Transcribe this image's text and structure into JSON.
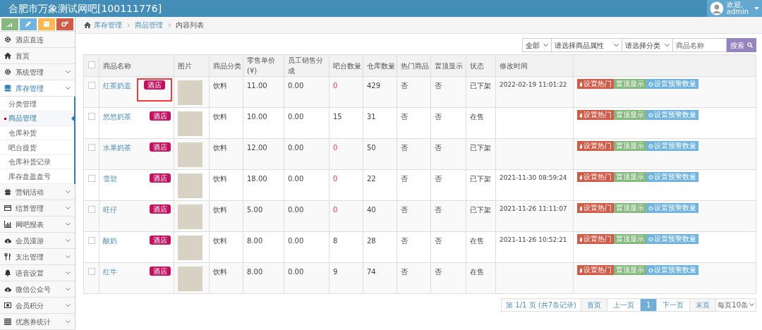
{
  "header": {
    "title": "合肥市万象测试网吧[100111776]",
    "welcome": "欢迎,",
    "user": "admin"
  },
  "sidebar": {
    "items": [
      {
        "label": "酒店直连",
        "expandable": false,
        "expanded": false
      },
      {
        "label": "首页",
        "expandable": false,
        "expanded": false
      },
      {
        "label": "系统管理",
        "expandable": true,
        "expanded": false
      },
      {
        "label": "库存管理",
        "expandable": true,
        "expanded": true,
        "children": [
          {
            "label": "分类管理",
            "selected": false
          },
          {
            "label": "商品管理",
            "selected": true
          },
          {
            "label": "仓库补货",
            "selected": false
          },
          {
            "label": "吧台提货",
            "selected": false
          },
          {
            "label": "仓库补货记录",
            "selected": false
          },
          {
            "label": "库存盘盈盘亏",
            "selected": false
          }
        ]
      },
      {
        "label": "营销活动",
        "expandable": true,
        "expanded": false
      },
      {
        "label": "结算管理",
        "expandable": true,
        "expanded": false
      },
      {
        "label": "网吧报表",
        "expandable": true,
        "expanded": false
      },
      {
        "label": "会员漫游",
        "expandable": true,
        "expanded": false
      },
      {
        "label": "支出管理",
        "expandable": true,
        "expanded": false
      },
      {
        "label": "语音设置",
        "expandable": true,
        "expanded": false
      },
      {
        "label": "微信公众号",
        "expandable": true,
        "expanded": false
      },
      {
        "label": "会员积分",
        "expandable": true,
        "expanded": false
      },
      {
        "label": "优惠券统计",
        "expandable": true,
        "expanded": false
      }
    ]
  },
  "breadcrumb": [
    "库存管理",
    "商品管理",
    "内容列表"
  ],
  "filters": {
    "scope": "全部",
    "attribute": "请选择商品属性",
    "category": "请选择分类",
    "search": {
      "placeholder": "商品名称"
    },
    "search_button": "搜索"
  },
  "table": {
    "select_all_checked": false,
    "columns": [
      "商品名称",
      "图片",
      "商品分类",
      "零售单价(¥)",
      "员工销售分成",
      "吧台数量",
      "仓库数量",
      "热门商品",
      "置顶显示",
      "状态",
      "修改时间"
    ],
    "rows": [
      {
        "name": "红茶奶盖",
        "badge": "酒店",
        "highlighted": true,
        "category": "饮料",
        "price": "11.00",
        "share": "0.00",
        "bar_qty": "0",
        "bar_alert": true,
        "stock": "429",
        "hot": "否",
        "top": "否",
        "status": "已下架",
        "modified": "2022-02-19 11:01:22",
        "checked": false,
        "actions": [
          "设置热门",
          "置顶显示",
          "设置预警数量"
        ]
      },
      {
        "name": "悠悠奶茶",
        "badge": "酒店",
        "highlighted": false,
        "category": "饮料",
        "price": "10.00",
        "share": "0.00",
        "bar_qty": "15",
        "bar_alert": false,
        "stock": "31",
        "hot": "否",
        "top": "否",
        "status": "在售",
        "checked": false,
        "actions": [
          "设置热门",
          "置顶显示",
          "设置预警数量"
        ]
      },
      {
        "name": "水果奶茶",
        "badge": "酒店",
        "highlighted": false,
        "category": "饮料",
        "price": "12.00",
        "share": "0.00",
        "bar_qty": "0",
        "bar_alert": true,
        "stock": "50",
        "hot": "否",
        "top": "否",
        "status": "已下架",
        "checked": false,
        "actions": [
          "设置热门",
          "置顶显示",
          "设置预警数量"
        ]
      },
      {
        "name": "雪碧",
        "badge": "酒店",
        "highlighted": false,
        "category": "饮料",
        "price": "18.00",
        "share": "0.00",
        "bar_qty": "0",
        "bar_alert": true,
        "stock": "22",
        "hot": "否",
        "top": "否",
        "status": "已下架",
        "modified": "2021-11-30 08:59:24",
        "checked": false,
        "actions": [
          "设置热门",
          "置顶显示",
          "设置预警数量"
        ]
      },
      {
        "name": "旺仔",
        "badge": "酒店",
        "highlighted": false,
        "category": "饮料",
        "price": "5.00",
        "share": "0.00",
        "bar_qty": "0",
        "bar_alert": true,
        "stock": "40",
        "hot": "否",
        "top": "否",
        "status": "已下架",
        "modified": "2021-11-26 11:11:07",
        "checked": false,
        "actions": [
          "设置热门",
          "置顶显示",
          "设置预警数量"
        ]
      },
      {
        "name": "酸奶",
        "badge": "酒店",
        "highlighted": false,
        "category": "饮料",
        "price": "8.00",
        "share": "0.00",
        "bar_qty": "8",
        "bar_alert": false,
        "stock": "28",
        "hot": "否",
        "top": "否",
        "status": "在售",
        "modified": "2021-11-26 10:52:21",
        "checked": false,
        "actions": [
          "设置热门",
          "置顶显示",
          "设置预警数量"
        ]
      },
      {
        "name": "红牛",
        "badge": "酒店",
        "highlighted": false,
        "category": "饮料",
        "price": "8.00",
        "share": "0.00",
        "bar_qty": "9",
        "bar_alert": false,
        "stock": "74",
        "hot": "否",
        "top": "否",
        "status": "在售",
        "checked": false,
        "actions": [
          "设置热门",
          "置顶显示",
          "设置预警数量"
        ]
      }
    ]
  },
  "pagination": {
    "summary": "第 1/1 页 (共7条记录)",
    "first": "首页",
    "prev": "上一页",
    "pages": [
      {
        "label": "1",
        "selected": true
      }
    ],
    "next": "下一页",
    "last": "末页",
    "page_size": "每页10条"
  }
}
